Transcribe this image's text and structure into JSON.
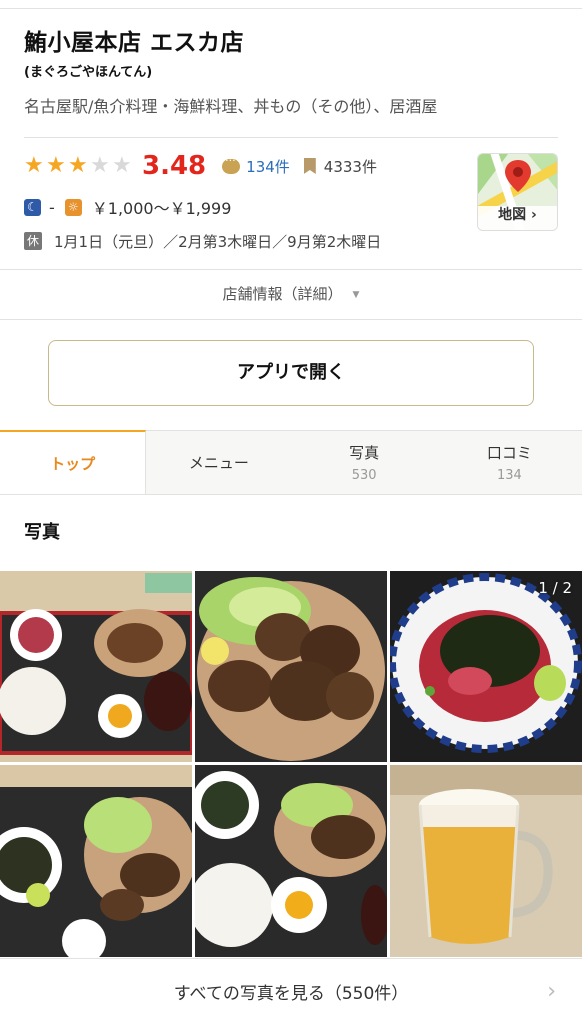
{
  "shop": {
    "name": "鮪小屋本店 エスカ店",
    "kana": "(まぐろごやほんてん)",
    "genre": "名古屋駅/魚介料理・海鮮料理、丼もの（その他）、居酒屋"
  },
  "rating": {
    "stars_filled": 3,
    "stars_total": 5,
    "score": "3.48",
    "reviews": "134件",
    "bookmarks": "4333件"
  },
  "price": {
    "dinner_icon": "☾",
    "dinner": "-",
    "lunch_icon": "☼",
    "lunch": "￥1,000～￥1,999"
  },
  "holiday": {
    "icon": "休",
    "text": "1月1日（元旦）／2月第3木曜日／9月第2木曜日"
  },
  "map": {
    "label": "地図 ›"
  },
  "store_info": {
    "label": "店舗情報（詳細）",
    "arrow": "▼"
  },
  "open_app": {
    "label": "アプリで開く"
  },
  "tabs": [
    {
      "label": "トップ",
      "count": ""
    },
    {
      "label": "メニュー",
      "count": ""
    },
    {
      "label": "写真",
      "count": "530"
    },
    {
      "label": "口コミ",
      "count": "134"
    }
  ],
  "photos": {
    "heading": "写真",
    "counter": "1 / 2",
    "see_all": "すべての写真を見る（550件）",
    "chevron": "›"
  },
  "colors": {
    "accent": "#f5a623",
    "score": "#e2261c",
    "link": "#2a6ebb"
  }
}
